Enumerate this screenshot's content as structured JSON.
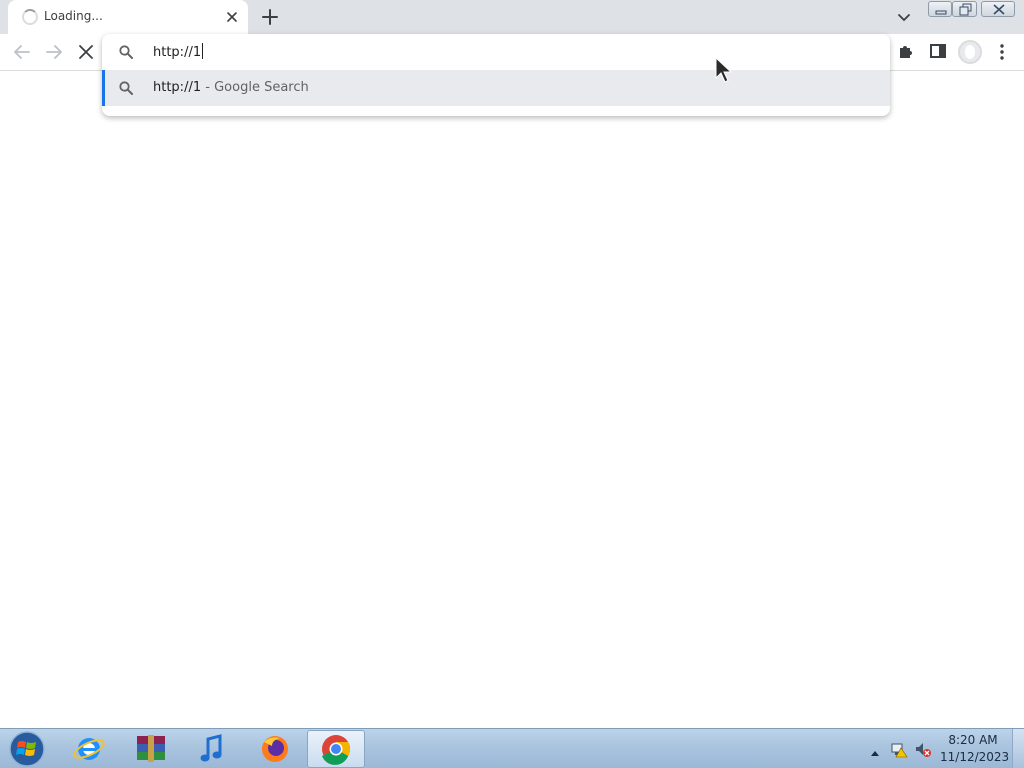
{
  "browser": {
    "tab": {
      "title": "Loading..."
    },
    "omnibox": {
      "input_value": "http://1",
      "suggestion": {
        "query": "http://1",
        "separator": "-",
        "description": "Google Search"
      }
    }
  },
  "taskbar": {
    "apps": [
      "internet-explorer",
      "winrar",
      "itunes",
      "firefox",
      "chrome"
    ],
    "active_app": "chrome",
    "clock": {
      "time": "8:20 AM",
      "date": "11/12/2023"
    }
  },
  "colors": {
    "tabstrip_bg": "#dee1e6",
    "suggestion_highlight": "#e8eaed",
    "suggestion_accent": "#1a73e8",
    "taskbar_bg": "#a8c3de"
  }
}
